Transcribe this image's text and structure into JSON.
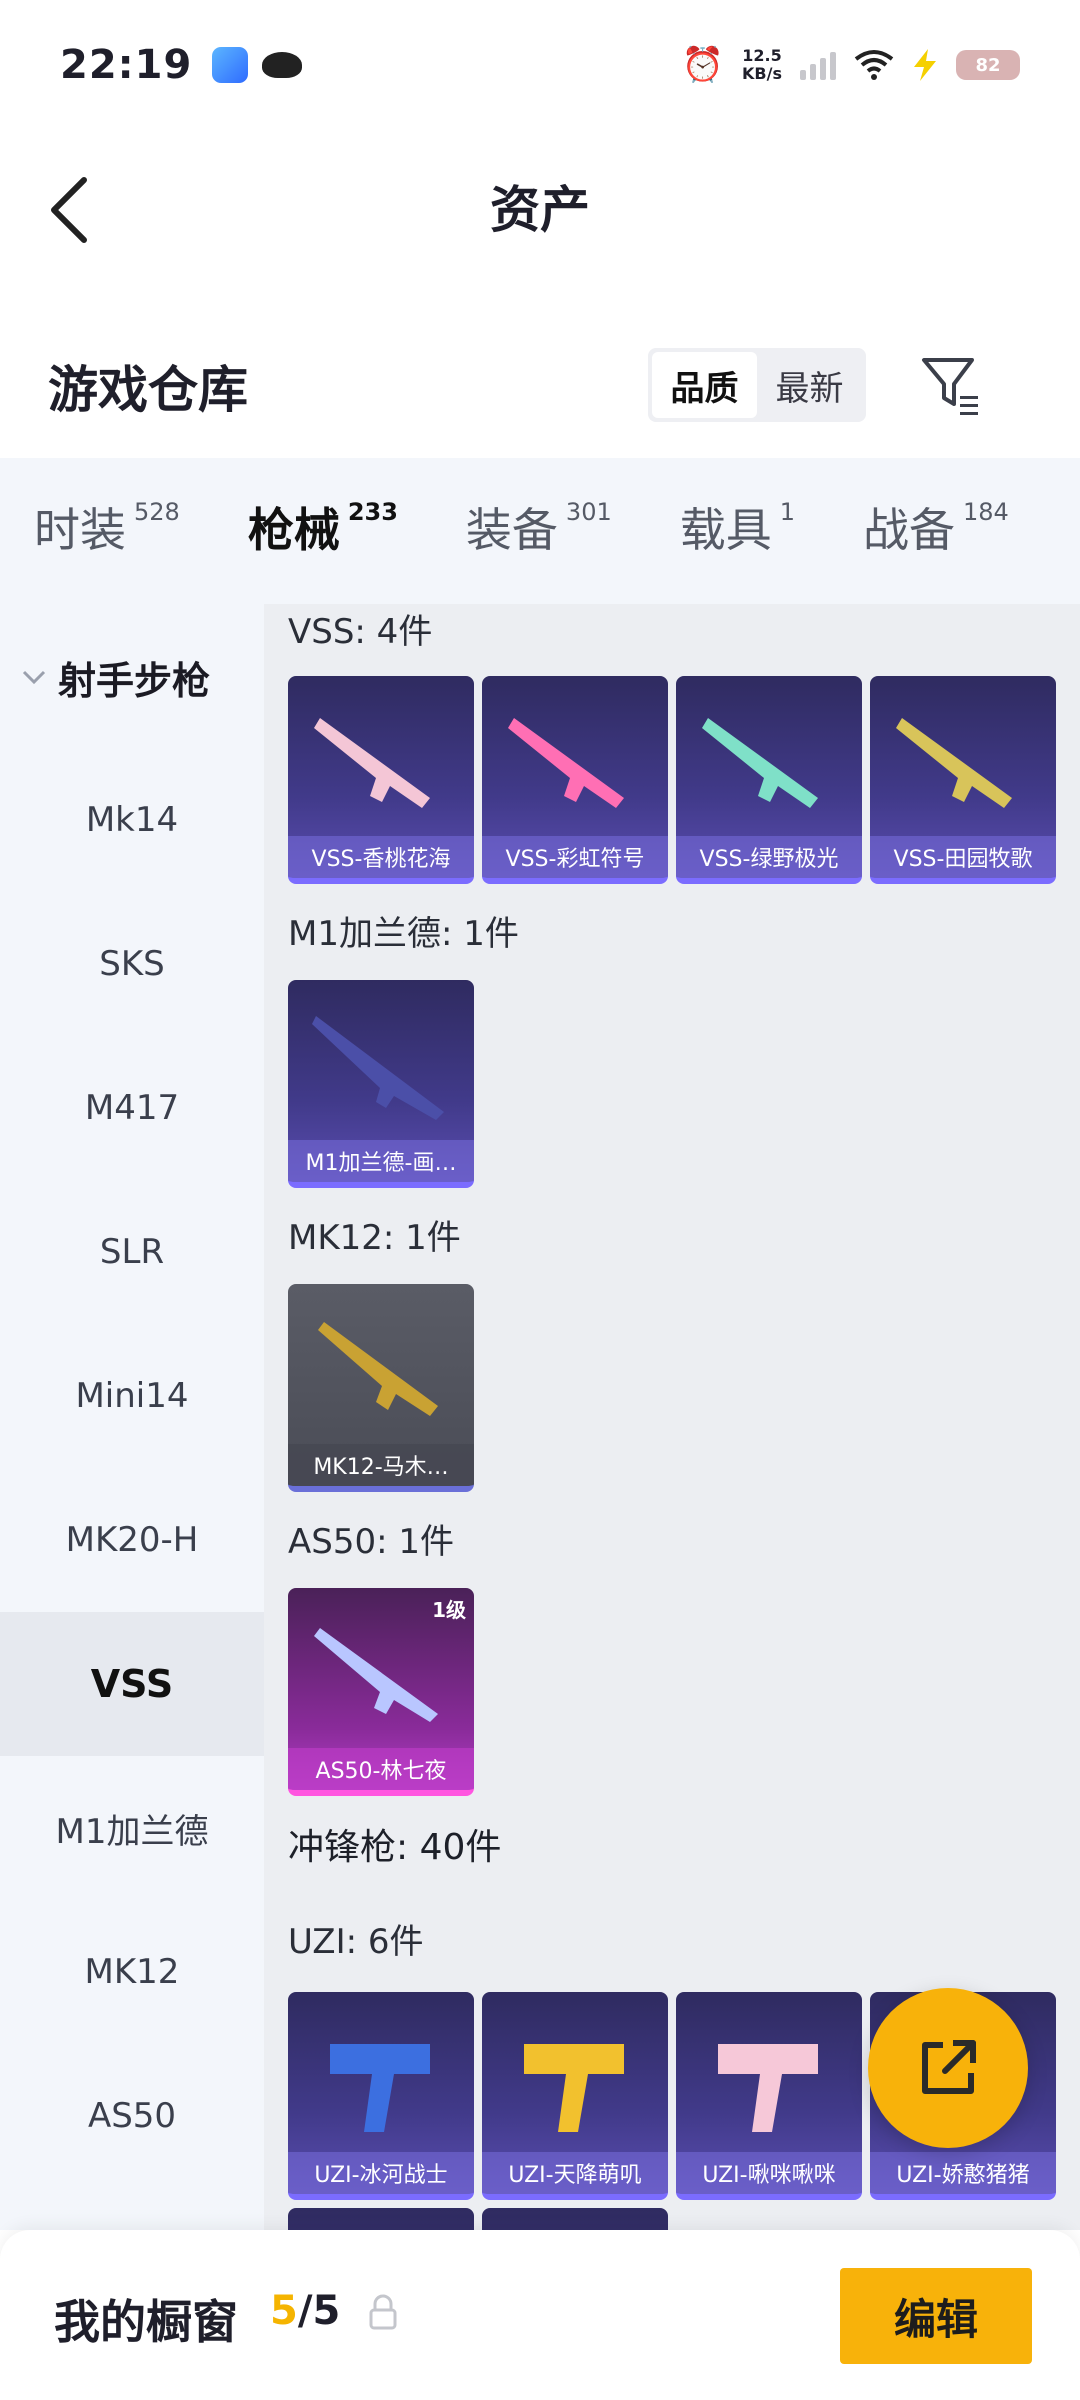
{
  "status_bar": {
    "time": "22:19",
    "net_speed_value": "12.5",
    "net_speed_unit": "KB/s",
    "battery": "82",
    "icons": [
      "alarm-icon",
      "signal-icon",
      "wifi-icon",
      "charging-icon"
    ]
  },
  "nav": {
    "title": "资产"
  },
  "warehouse": {
    "title": "游戏仓库",
    "sort_options": [
      "品质",
      "最新"
    ],
    "active_sort": "品质"
  },
  "category_tabs": [
    {
      "label": "时装",
      "count": "528"
    },
    {
      "label": "枪械",
      "count": "233",
      "active": true
    },
    {
      "label": "装备",
      "count": "301"
    },
    {
      "label": "载具",
      "count": "1"
    },
    {
      "label": "战备",
      "count": "184"
    }
  ],
  "sidebar": {
    "group_label": "射手步枪",
    "items": [
      "Mk14",
      "SKS",
      "M417",
      "SLR",
      "Mini14",
      "MK20-H",
      "VSS",
      "M1加兰德",
      "MK12",
      "AS50"
    ],
    "active_item": "VSS"
  },
  "sections": [
    {
      "title": "VSS: 4件",
      "items": [
        "VSS-香桃花海",
        "VSS-彩虹符号",
        "VSS-绿野极光",
        "VSS-田园牧歌"
      ]
    },
    {
      "title": "M1加兰德: 1件",
      "items": [
        "M1加兰德-画…"
      ]
    },
    {
      "title": "MK12: 1件",
      "items": [
        "MK12-马木…"
      ]
    },
    {
      "title": "AS50: 1件",
      "items": [
        "AS50-林七夜"
      ],
      "badge": "1级"
    },
    {
      "title": "冲锋枪: 40件"
    },
    {
      "title": "UZI: 6件",
      "items": [
        "UZI-冰河战士",
        "UZI-天降萌叽",
        "UZI-啾咪啾咪",
        "UZI-娇憨猪猪"
      ]
    }
  ],
  "bottom_bar": {
    "label": "我的橱窗",
    "count_current": "5",
    "count_sep": "/",
    "count_total": "5",
    "edit_label": "编辑"
  },
  "colors": {
    "accent": "#f8b20a",
    "card_purple": "#413a8a",
    "card_pink": "#b23fc4"
  }
}
